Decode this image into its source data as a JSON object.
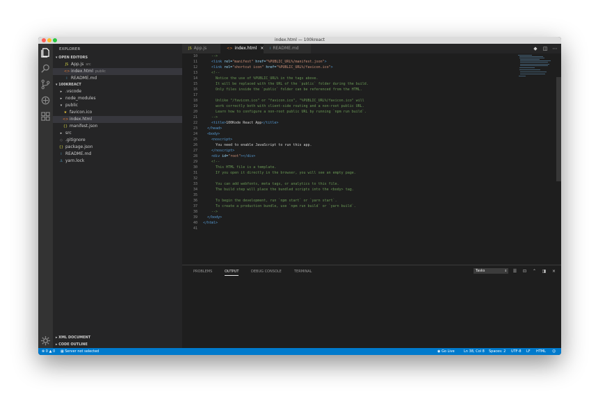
{
  "window": {
    "title": "index.html — 100kreact"
  },
  "sidebar": {
    "title": "EXPLORER",
    "open_editors": {
      "label": "OPEN EDITORS",
      "items": [
        {
          "name": "App.js",
          "desc": "src",
          "icon": "JS"
        },
        {
          "name": "index.html",
          "desc": "public",
          "icon": "<>"
        },
        {
          "name": "README.md",
          "desc": "",
          "icon": "i"
        }
      ]
    },
    "project": {
      "label": "100KREACT",
      "items": [
        {
          "name": ".vscode",
          "arrow": "▸",
          "indent": 0
        },
        {
          "name": "node_modules",
          "arrow": "▸",
          "indent": 0
        },
        {
          "name": "public",
          "arrow": "▾",
          "indent": 0
        },
        {
          "name": "favicon.ico",
          "icon": "★",
          "indent": 1
        },
        {
          "name": "index.html",
          "icon": "<>",
          "indent": 1
        },
        {
          "name": "manifest.json",
          "icon": "{}",
          "indent": 1
        },
        {
          "name": "src",
          "arrow": "▸",
          "indent": 0
        },
        {
          "name": ".gitignore",
          "icon": "◇",
          "indent": 0
        },
        {
          "name": "package.json",
          "icon": "{}",
          "indent": 0
        },
        {
          "name": "README.md",
          "icon": "i",
          "indent": 0
        },
        {
          "name": "yarn.lock",
          "icon": "⚓",
          "indent": 0
        }
      ]
    },
    "bottom_sections": [
      "XML DOCUMENT",
      "CODE OUTLINE"
    ]
  },
  "tabs": [
    {
      "label": "App.js",
      "icon": "JS"
    },
    {
      "label": "index.html",
      "icon": "<>",
      "close": "×"
    },
    {
      "label": "README.md",
      "icon": "i"
    }
  ],
  "editor": {
    "lines": [
      {
        "n": "10",
        "seg": [
          [
            "cmt",
            "    -->"
          ]
        ]
      },
      {
        "n": "11",
        "seg": [
          [
            "txt",
            "    "
          ],
          [
            "tag",
            "<link "
          ],
          [
            "attr",
            "rel="
          ],
          [
            "str",
            "\"manifest\""
          ],
          [
            "attr",
            " href="
          ],
          [
            "str",
            "\"%PUBLIC_URL%/manifest.json\""
          ],
          [
            "tag",
            ">"
          ]
        ]
      },
      {
        "n": "12",
        "seg": [
          [
            "txt",
            "    "
          ],
          [
            "tag",
            "<link "
          ],
          [
            "attr",
            "rel="
          ],
          [
            "str",
            "\"shortcut icon\""
          ],
          [
            "attr",
            " href="
          ],
          [
            "str",
            "\"%PUBLIC_URL%/favicon.ico\""
          ],
          [
            "tag",
            ">"
          ]
        ]
      },
      {
        "n": "13",
        "seg": [
          [
            "cmt",
            "    <!--"
          ]
        ]
      },
      {
        "n": "14",
        "seg": [
          [
            "cmt",
            "      Notice the use of %PUBLIC_URL% in the tags above."
          ]
        ]
      },
      {
        "n": "15",
        "seg": [
          [
            "cmt",
            "      It will be replaced with the URL of the `public` folder during the build."
          ]
        ]
      },
      {
        "n": "16",
        "seg": [
          [
            "cmt",
            "      Only files inside the `public` folder can be referenced from the HTML."
          ]
        ]
      },
      {
        "n": "17",
        "seg": []
      },
      {
        "n": "18",
        "seg": [
          [
            "cmt",
            "      Unlike \"/favicon.ico\" or \"favicon.ico\", \"%PUBLIC_URL%/favicon.ico\" will"
          ]
        ]
      },
      {
        "n": "19",
        "seg": [
          [
            "cmt",
            "      work correctly both with client-side routing and a non-root public URL."
          ]
        ]
      },
      {
        "n": "20",
        "seg": [
          [
            "cmt",
            "      Learn how to configure a non-root public URL by running `npm run build`."
          ]
        ]
      },
      {
        "n": "21",
        "seg": [
          [
            "cmt",
            "    -->"
          ]
        ]
      },
      {
        "n": "22",
        "seg": [
          [
            "txt",
            "    "
          ],
          [
            "tag",
            "<title>"
          ],
          [
            "txt",
            "100Kode React App"
          ],
          [
            "tag",
            "</title>"
          ]
        ]
      },
      {
        "n": "23",
        "seg": [
          [
            "txt",
            "  "
          ],
          [
            "tag",
            "</head>"
          ]
        ]
      },
      {
        "n": "24",
        "seg": [
          [
            "txt",
            "  "
          ],
          [
            "tag",
            "<body>"
          ]
        ]
      },
      {
        "n": "25",
        "seg": [
          [
            "txt",
            "    "
          ],
          [
            "tag",
            "<noscript>"
          ]
        ]
      },
      {
        "n": "26",
        "seg": [
          [
            "txt",
            "      You need to enable JavaScript to run this app."
          ]
        ]
      },
      {
        "n": "27",
        "seg": [
          [
            "txt",
            "    "
          ],
          [
            "tag",
            "</noscript>"
          ]
        ]
      },
      {
        "n": "28",
        "seg": [
          [
            "txt",
            "    "
          ],
          [
            "tag",
            "<div "
          ],
          [
            "attr",
            "id="
          ],
          [
            "str",
            "\"root\""
          ],
          [
            "tag",
            "></div>"
          ]
        ]
      },
      {
        "n": "29",
        "seg": [
          [
            "cmt",
            "    <!--"
          ]
        ]
      },
      {
        "n": "30",
        "seg": [
          [
            "cmt",
            "      This HTML file is a template."
          ]
        ]
      },
      {
        "n": "31",
        "seg": [
          [
            "cmt",
            "      If you open it directly in the browser, you will see an empty page."
          ]
        ]
      },
      {
        "n": "32",
        "seg": []
      },
      {
        "n": "33",
        "seg": [
          [
            "cmt",
            "      You can add webfonts, meta tags, or analytics to this file."
          ]
        ]
      },
      {
        "n": "34",
        "seg": [
          [
            "cmt",
            "      The build step will place the bundled scripts into the <body> tag."
          ]
        ]
      },
      {
        "n": "35",
        "seg": []
      },
      {
        "n": "36",
        "seg": [
          [
            "cmt",
            "      To begin the development, run `npm start` or `yarn start`."
          ]
        ]
      },
      {
        "n": "37",
        "seg": [
          [
            "cmt",
            "      To create a production bundle, use `npm run build` or `yarn build`."
          ]
        ]
      },
      {
        "n": "38",
        "seg": [
          [
            "cmt",
            "    -->"
          ]
        ]
      },
      {
        "n": "39",
        "seg": [
          [
            "txt",
            "  "
          ],
          [
            "tag",
            "</body>"
          ]
        ]
      },
      {
        "n": "40",
        "seg": [
          [
            "tag",
            "</html>"
          ]
        ]
      },
      {
        "n": "41",
        "seg": []
      }
    ]
  },
  "panel": {
    "tabs": [
      "PROBLEMS",
      "OUTPUT",
      "DEBUG CONSOLE",
      "TERMINAL"
    ],
    "active_tab": "OUTPUT",
    "select_value": "Tasks",
    "icons": [
      "clear-output-icon",
      "lock-scroll-icon",
      "chevron-up-icon",
      "split-panel-icon",
      "close-icon"
    ]
  },
  "status": {
    "errors": "0",
    "warnings": "0",
    "server": "Server not selected",
    "go_live": "Go Live",
    "position": "Ln 38, Col 8",
    "spaces": "Spaces: 2",
    "encoding": "UTF-8",
    "eol": "LF",
    "language": "HTML"
  },
  "colors": {
    "status_bar": "#007acc",
    "editor_bg": "#1e1e1e",
    "sidebar_bg": "#252526",
    "activity_bg": "#333333"
  }
}
